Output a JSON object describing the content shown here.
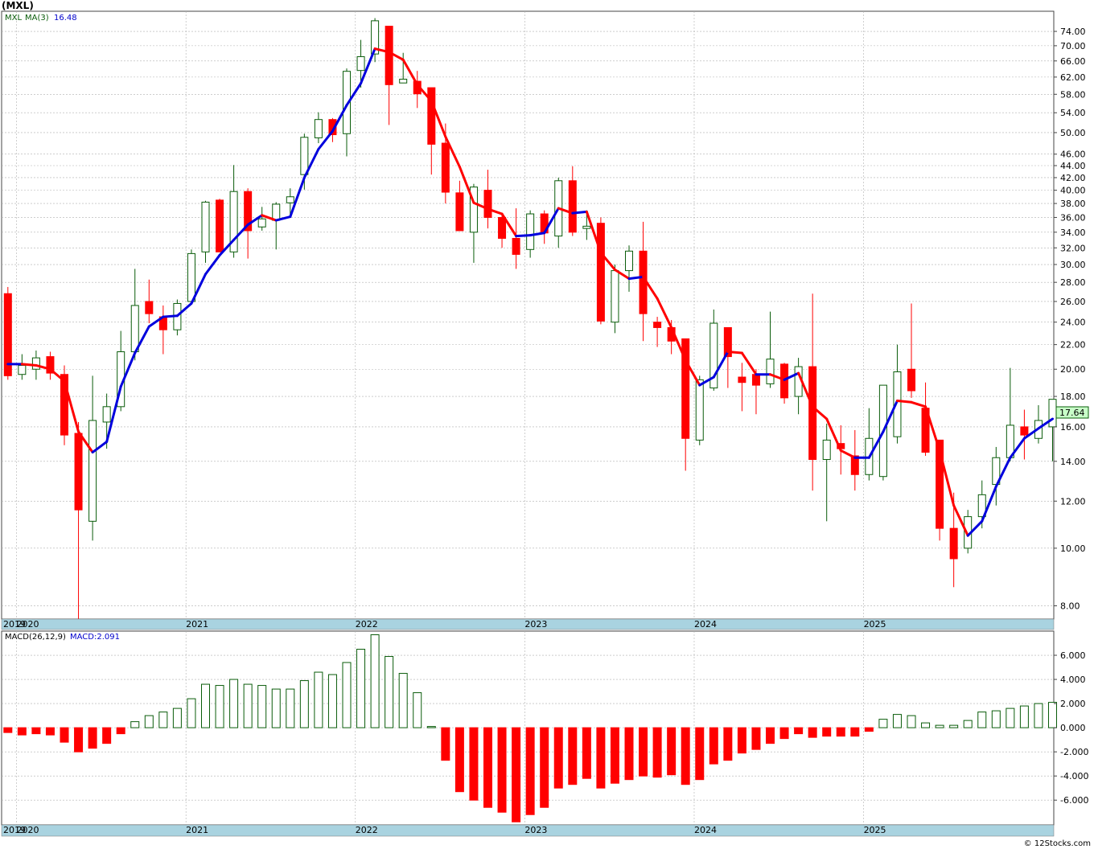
{
  "title": "(MXL)",
  "watermark": "© 12Stocks.com",
  "colors": {
    "up": "#0a5c0a",
    "down": "#ff0000",
    "ma_up": "#0000dd",
    "ma_down": "#ff0000",
    "axis_band": "#a9d3e0",
    "grid": "#b0b0b0",
    "last_price_box": "#c8ffc8"
  },
  "price_panel": {
    "symbol_label": "MXL",
    "ma_label": "MA(3)",
    "ma_value": "16.48",
    "last_price": "17.64",
    "y_ticks": [
      "74.00",
      "70.00",
      "66.00",
      "62.00",
      "58.00",
      "54.00",
      "50.00",
      "46.00",
      "44.00",
      "42.00",
      "40.00",
      "38.00",
      "36.00",
      "34.00",
      "32.00",
      "30.00",
      "28.00",
      "26.00",
      "24.00",
      "22.00",
      "20.00",
      "18.00",
      "16.00",
      "14.00",
      "12.00",
      "10.00",
      "8.00"
    ]
  },
  "macd_panel": {
    "label": "MACD(26,12,9)",
    "value_label": "MACD:2.091",
    "y_ticks": [
      "6.000",
      "4.000",
      "2.000",
      "0.000",
      "-2.000",
      "-4.000",
      "-6.000"
    ]
  },
  "x_axis": {
    "years": [
      "2019",
      "2020",
      "2021",
      "2022",
      "2023",
      "2024",
      "2025"
    ]
  },
  "chart_data": {
    "type": "candlestick",
    "scale": "log",
    "ylim": [
      7.6,
      80
    ],
    "interval": "monthly",
    "start": "2019-12",
    "ohlc": [
      [
        26.8,
        27.5,
        19.2,
        19.5
      ],
      [
        19.6,
        21.2,
        19.2,
        20.3
      ],
      [
        20.0,
        21.5,
        19.2,
        20.9
      ],
      [
        21.0,
        21.4,
        19.2,
        19.7
      ],
      [
        19.6,
        20.3,
        14.9,
        15.5
      ],
      [
        15.6,
        16.3,
        7.6,
        11.6
      ],
      [
        11.1,
        19.5,
        10.3,
        16.4
      ],
      [
        16.3,
        18.2,
        14.7,
        17.3
      ],
      [
        17.3,
        23.2,
        17.0,
        21.4
      ],
      [
        21.4,
        29.5,
        20.7,
        25.6
      ],
      [
        26.0,
        28.3,
        23.9,
        24.8
      ],
      [
        24.5,
        25.6,
        21.2,
        23.3
      ],
      [
        23.3,
        26.2,
        22.8,
        25.8
      ],
      [
        26.0,
        31.8,
        26.8,
        31.3
      ],
      [
        31.5,
        38.4,
        30.2,
        38.2
      ],
      [
        38.5,
        38.7,
        31.5,
        31.5
      ],
      [
        31.5,
        44.1,
        30.8,
        39.8
      ],
      [
        39.8,
        40.3,
        30.7,
        34.2
      ],
      [
        34.7,
        37.5,
        34.2,
        35.8
      ],
      [
        35.6,
        38.2,
        31.8,
        37.9
      ],
      [
        38.1,
        40.3,
        36.1,
        39.0
      ],
      [
        42.5,
        49.8,
        40.1,
        49.1
      ],
      [
        49.0,
        54.1,
        48.0,
        52.6
      ],
      [
        52.6,
        52.9,
        48.2,
        49.6
      ],
      [
        49.8,
        64.1,
        45.6,
        63.4
      ],
      [
        63.6,
        71.6,
        59.5,
        67.1
      ],
      [
        67.8,
        77.9,
        65.7,
        77.1
      ],
      [
        75.5,
        75.5,
        51.5,
        60.2
      ],
      [
        60.6,
        68.1,
        60.6,
        61.5
      ],
      [
        61.0,
        63.5,
        55.0,
        58.1
      ],
      [
        59.5,
        59.5,
        42.5,
        47.8
      ],
      [
        48.0,
        51.8,
        38.0,
        39.7
      ],
      [
        39.6,
        41.5,
        34.2,
        34.2
      ],
      [
        34.0,
        41.0,
        30.2,
        40.5
      ],
      [
        40.0,
        43.3,
        34.5,
        36.0
      ],
      [
        36.0,
        36.3,
        32.0,
        33.2
      ],
      [
        33.2,
        37.3,
        29.5,
        31.2
      ],
      [
        31.8,
        37.0,
        30.8,
        36.5
      ],
      [
        36.5,
        37.0,
        32.5,
        33.9
      ],
      [
        33.5,
        42.0,
        32.0,
        41.5
      ],
      [
        41.5,
        43.9,
        33.5,
        34.0
      ],
      [
        34.5,
        37.0,
        33.0,
        34.8
      ],
      [
        35.2,
        36.0,
        23.8,
        24.1
      ],
      [
        24.0,
        30.0,
        23.0,
        29.3
      ],
      [
        29.3,
        32.3,
        27.0,
        31.6
      ],
      [
        31.6,
        35.4,
        22.3,
        24.8
      ],
      [
        24.0,
        24.5,
        21.8,
        23.5
      ],
      [
        23.5,
        24.2,
        21.2,
        22.3
      ],
      [
        22.5,
        22.5,
        13.5,
        15.3
      ],
      [
        15.2,
        19.5,
        14.9,
        19.2
      ],
      [
        18.6,
        25.2,
        18.4,
        23.9
      ],
      [
        23.5,
        23.5,
        18.6,
        21.0
      ],
      [
        19.4,
        20.5,
        17.0,
        19.0
      ],
      [
        19.6,
        20.0,
        16.8,
        18.8
      ],
      [
        18.9,
        25.0,
        18.6,
        20.8
      ],
      [
        20.4,
        20.5,
        17.5,
        17.9
      ],
      [
        18.0,
        20.9,
        16.8,
        20.2
      ],
      [
        20.2,
        26.8,
        12.5,
        14.1
      ],
      [
        14.1,
        16.2,
        11.1,
        15.2
      ],
      [
        15.0,
        16.1,
        13.3,
        14.7
      ],
      [
        14.3,
        15.8,
        12.5,
        13.3
      ],
      [
        13.3,
        17.2,
        13.0,
        15.3
      ],
      [
        13.2,
        17.5,
        13.0,
        18.8
      ],
      [
        15.4,
        22.0,
        15.0,
        19.8
      ],
      [
        20.0,
        25.8,
        17.9,
        18.4
      ],
      [
        17.2,
        19.0,
        14.3,
        14.5
      ],
      [
        15.2,
        15.2,
        10.3,
        10.8
      ],
      [
        10.8,
        12.4,
        8.6,
        9.6
      ],
      [
        10.0,
        11.6,
        9.8,
        11.3
      ],
      [
        11.3,
        13.0,
        10.8,
        12.3
      ],
      [
        12.8,
        14.8,
        11.8,
        14.2
      ],
      [
        14.2,
        20.1,
        14.0,
        16.1
      ],
      [
        16.0,
        17.1,
        14.1,
        15.5
      ],
      [
        15.3,
        17.4,
        15.0,
        16.4
      ],
      [
        16.0,
        17.8,
        14.0,
        17.8
      ]
    ],
    "ma": [
      20.4,
      20.4,
      20.3,
      20.0,
      19.1,
      15.7,
      14.5,
      15.1,
      18.7,
      21.3,
      23.6,
      24.5,
      24.6,
      25.8,
      28.9,
      31.1,
      33.0,
      35.0,
      36.3,
      35.6,
      36.1,
      42.0,
      46.9,
      50.3,
      55.6,
      60.5,
      69.2,
      68.3,
      66.3,
      60.2,
      56.5,
      49.2,
      43.8,
      38.1,
      37.2,
      36.5,
      33.5,
      33.6,
      33.9,
      37.3,
      36.6,
      36.8,
      31.4,
      29.4,
      28.4,
      28.6,
      26.3,
      23.5,
      20.7,
      18.8,
      19.4,
      21.4,
      21.3,
      19.6,
      19.6,
      19.2,
      19.7,
      17.3,
      16.5,
      14.6,
      14.2,
      14.2,
      15.7,
      17.7,
      17.6,
      17.3,
      14.6,
      11.8,
      10.5,
      11.1,
      12.7,
      14.2,
      15.3,
      15.9,
      16.5
    ],
    "macd": [
      -0.4,
      -0.6,
      -0.5,
      -0.6,
      -1.2,
      -2.0,
      -1.7,
      -1.3,
      -0.5,
      0.5,
      1.0,
      1.3,
      1.6,
      2.4,
      3.6,
      3.5,
      4.0,
      3.6,
      3.5,
      3.2,
      3.2,
      3.9,
      4.6,
      4.4,
      5.4,
      6.5,
      7.7,
      5.9,
      4.5,
      2.9,
      0.1,
      -2.7,
      -5.3,
      -6.0,
      -6.6,
      -7.0,
      -7.8,
      -7.2,
      -6.6,
      -5.0,
      -4.7,
      -4.2,
      -5.0,
      -4.6,
      -4.3,
      -4.0,
      -4.1,
      -3.9,
      -4.7,
      -4.3,
      -3.0,
      -2.7,
      -2.1,
      -1.8,
      -1.3,
      -0.9,
      -0.5,
      -0.8,
      -0.7,
      -0.7,
      -0.7,
      -0.3,
      0.7,
      1.1,
      1.0,
      0.4,
      0.2,
      0.2,
      0.6,
      1.3,
      1.4,
      1.6,
      1.8,
      2.0,
      2.1
    ]
  }
}
